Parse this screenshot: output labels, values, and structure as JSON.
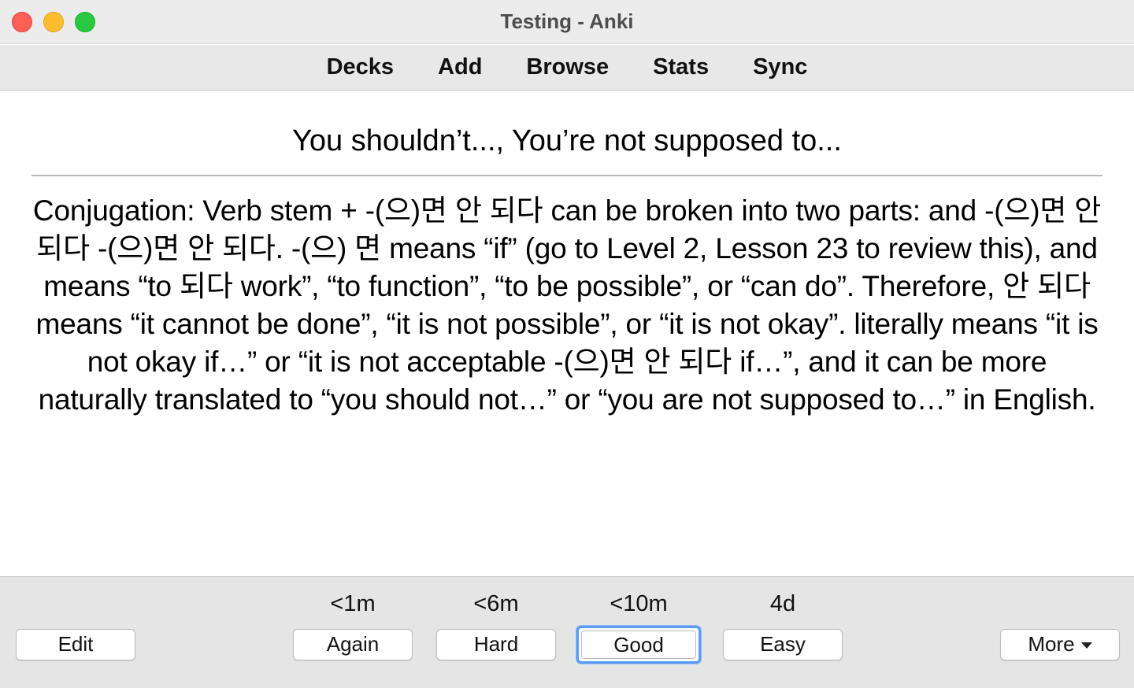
{
  "window": {
    "title": "Testing - Anki"
  },
  "toolbar": {
    "items": [
      "Decks",
      "Add",
      "Browse",
      "Stats",
      "Sync"
    ]
  },
  "card": {
    "front": "You shouldn’t..., You’re not supposed to...",
    "back": "Conjugation: Verb stem + -(으)면 안 되다 can be broken into two parts: and -(으)면 안 되다 -(으)면 안 되다. -(으) 면 means “if” (go to Level 2, Lesson 23 to review this), and means “to 되다 work”, “to function”, “to be possible”, or “can do”. Therefore, 안 되다 means “it cannot be done”, “it is not possible”, or “it is not okay”. literally means “it is not okay if…” or “it is not acceptable -(으)면 안 되다 if…”, and it can be more naturally translated to “you should not…” or “you are not supposed to…” in English."
  },
  "answer_bar": {
    "edit_label": "Edit",
    "more_label": "More",
    "buttons": [
      {
        "label": "Again",
        "interval": "<1m"
      },
      {
        "label": "Hard",
        "interval": "<6m"
      },
      {
        "label": "Good",
        "interval": "<10m"
      },
      {
        "label": "Easy",
        "interval": "4d"
      }
    ]
  },
  "colors": {
    "focus_ring": "#5b9cf6",
    "close": "#fe5f57",
    "minimize": "#febc2e",
    "maximize": "#28c840"
  }
}
